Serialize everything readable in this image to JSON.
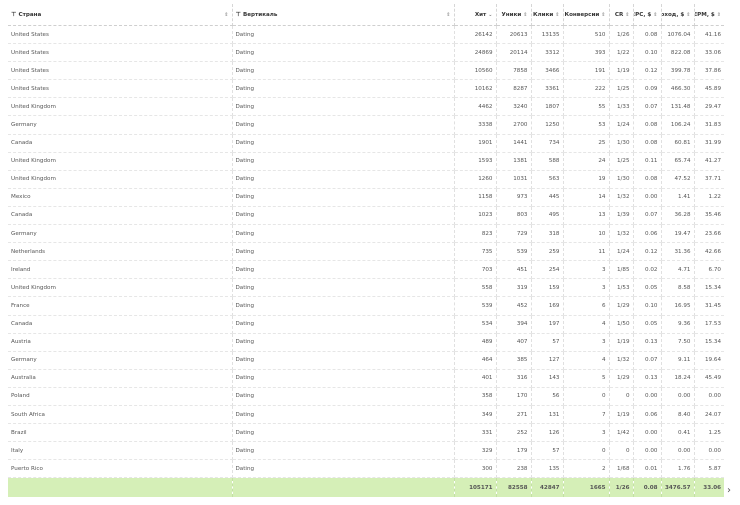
{
  "columns": [
    {
      "label": "Страна",
      "filter": true
    },
    {
      "label": "Вертикаль",
      "filter": true
    },
    {
      "label": "Хит",
      "sort": "⌄"
    },
    {
      "label": "Уники",
      "sort": "⇕"
    },
    {
      "label": "Клики",
      "sort": "⇕"
    },
    {
      "label": "Конверсии",
      "sort": "⇕"
    },
    {
      "label": "CR",
      "sort": "⇕"
    },
    {
      "label": "EPC, $",
      "sort": "⇕"
    },
    {
      "label": "Доход, $",
      "sort": "⇕"
    },
    {
      "label": "EPM, $",
      "sort": "⇕"
    }
  ],
  "rows": [
    [
      "United States",
      "Dating",
      "26142",
      "20613",
      "13135",
      "510",
      "1/26",
      "0.08",
      "1076.04",
      "41.16"
    ],
    [
      "United States",
      "Dating",
      "24869",
      "20114",
      "3312",
      "393",
      "1/22",
      "0.10",
      "822.08",
      "33.06"
    ],
    [
      "United States",
      "Dating",
      "10560",
      "7858",
      "3466",
      "191",
      "1/19",
      "0.12",
      "399.78",
      "37.86"
    ],
    [
      "United States",
      "Dating",
      "10162",
      "8287",
      "3361",
      "222",
      "1/25",
      "0.09",
      "466.30",
      "45.89"
    ],
    [
      "United Kingdom",
      "Dating",
      "4462",
      "3240",
      "1807",
      "55",
      "1/33",
      "0.07",
      "131.48",
      "29.47"
    ],
    [
      "Germany",
      "Dating",
      "3338",
      "2700",
      "1250",
      "53",
      "1/24",
      "0.08",
      "106.24",
      "31.83"
    ],
    [
      "Canada",
      "Dating",
      "1901",
      "1441",
      "734",
      "25",
      "1/30",
      "0.08",
      "60.81",
      "31.99"
    ],
    [
      "United Kingdom",
      "Dating",
      "1593",
      "1381",
      "588",
      "24",
      "1/25",
      "0.11",
      "65.74",
      "41.27"
    ],
    [
      "United Kingdom",
      "Dating",
      "1260",
      "1031",
      "563",
      "19",
      "1/30",
      "0.08",
      "47.52",
      "37.71"
    ],
    [
      "Mexico",
      "Dating",
      "1158",
      "973",
      "445",
      "14",
      "1/32",
      "0.00",
      "1.41",
      "1.22"
    ],
    [
      "Canada",
      "Dating",
      "1023",
      "803",
      "495",
      "13",
      "1/39",
      "0.07",
      "36.28",
      "35.46"
    ],
    [
      "Germany",
      "Dating",
      "823",
      "729",
      "318",
      "10",
      "1/32",
      "0.06",
      "19.47",
      "23.66"
    ],
    [
      "Netherlands",
      "Dating",
      "735",
      "539",
      "259",
      "11",
      "1/24",
      "0.12",
      "31.36",
      "42.66"
    ],
    [
      "Ireland",
      "Dating",
      "703",
      "451",
      "254",
      "3",
      "1/85",
      "0.02",
      "4.71",
      "6.70"
    ],
    [
      "United Kingdom",
      "Dating",
      "558",
      "319",
      "159",
      "3",
      "1/53",
      "0.05",
      "8.58",
      "15.34"
    ],
    [
      "France",
      "Dating",
      "539",
      "452",
      "169",
      "6",
      "1/29",
      "0.10",
      "16.95",
      "31.45"
    ],
    [
      "Canada",
      "Dating",
      "534",
      "394",
      "197",
      "4",
      "1/50",
      "0.05",
      "9.36",
      "17.53"
    ],
    [
      "Austria",
      "Dating",
      "489",
      "407",
      "57",
      "3",
      "1/19",
      "0.13",
      "7.50",
      "15.34"
    ],
    [
      "Germany",
      "Dating",
      "464",
      "385",
      "127",
      "4",
      "1/32",
      "0.07",
      "9.11",
      "19.64"
    ],
    [
      "Australia",
      "Dating",
      "401",
      "316",
      "143",
      "5",
      "1/29",
      "0.13",
      "18.24",
      "45.49"
    ],
    [
      "Poland",
      "Dating",
      "358",
      "170",
      "56",
      "0",
      "0",
      "0.00",
      "0.00",
      "0.00"
    ],
    [
      "South Africa",
      "Dating",
      "349",
      "271",
      "131",
      "7",
      "1/19",
      "0.06",
      "8.40",
      "24.07"
    ],
    [
      "Brazil",
      "Dating",
      "331",
      "252",
      "126",
      "3",
      "1/42",
      "0.00",
      "0.41",
      "1.25"
    ],
    [
      "Italy",
      "Dating",
      "329",
      "179",
      "57",
      "0",
      "0",
      "0.00",
      "0.00",
      "0.00"
    ],
    [
      "Puerto Rico",
      "Dating",
      "300",
      "238",
      "135",
      "2",
      "1/68",
      "0.01",
      "1.76",
      "5.87"
    ]
  ],
  "totals": [
    "",
    "",
    "105171",
    "82558",
    "42847",
    "1665",
    "1/26",
    "0.08",
    "3476.57",
    "33.06"
  ],
  "icons": {
    "filter": "filter-icon",
    "sort": "sort-icon",
    "more": "chevron-right-icon"
  }
}
